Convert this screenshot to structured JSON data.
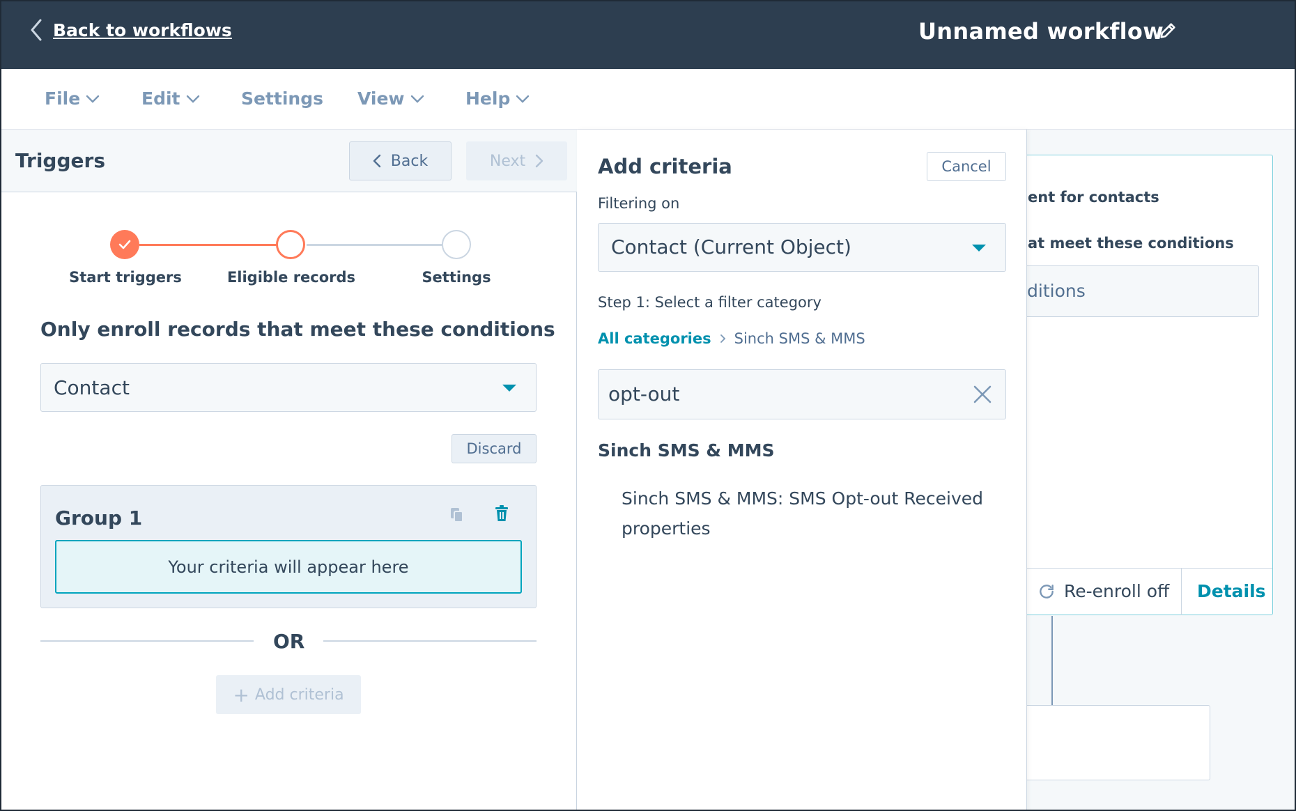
{
  "header": {
    "back_label": "Back to workflows",
    "workflow_title": "Unnamed workflow"
  },
  "menu": {
    "file": "File",
    "edit": "Edit",
    "settings": "Settings",
    "view": "View",
    "help": "Help"
  },
  "triggers": {
    "title": "Triggers",
    "back_button": "Back",
    "next_button": "Next",
    "steps": [
      {
        "label": "Start triggers",
        "state": "complete"
      },
      {
        "label": "Eligible records",
        "state": "current"
      },
      {
        "label": "Settings",
        "state": "upcoming"
      }
    ],
    "conditions_heading": "Only enroll records that meet these conditions",
    "object_select_value": "Contact",
    "discard_button": "Discard",
    "group_title": "Group 1",
    "criteria_placeholder": "Your criteria will appear here",
    "or_label": "OR",
    "add_criteria_button": "Add criteria"
  },
  "add_criteria": {
    "title": "Add criteria",
    "cancel_button": "Cancel",
    "filtering_on_label": "Filtering on",
    "filtering_on_value": "Contact (Current Object)",
    "step_label": "Step 1: Select a filter category",
    "breadcrumb_root": "All categories",
    "breadcrumb_current": "Sinch SMS & MMS",
    "search_value": "opt-out",
    "result_group": "Sinch SMS & MMS",
    "result_item": "Sinch SMS & MMS: SMS Opt-out Received properties"
  },
  "workflow_card": {
    "line1": "ent for contacts",
    "line2": "at meet these conditions",
    "box_text": "ditions",
    "reenroll_label": "Re-enroll off",
    "details_label": "Details"
  },
  "colors": {
    "header_bg": "#2d3e50",
    "accent_teal": "#0091ae",
    "step_complete": "#ff7a59",
    "criteria_border": "#00a4bd"
  },
  "icons": {
    "back": "chevron-left-icon",
    "edit": "pencil-icon",
    "menu_caret": "chevron-down-icon",
    "step_complete": "check-icon",
    "copy": "copy-icon",
    "delete": "trash-icon",
    "clear": "close-icon",
    "reenroll": "refresh-icon"
  }
}
